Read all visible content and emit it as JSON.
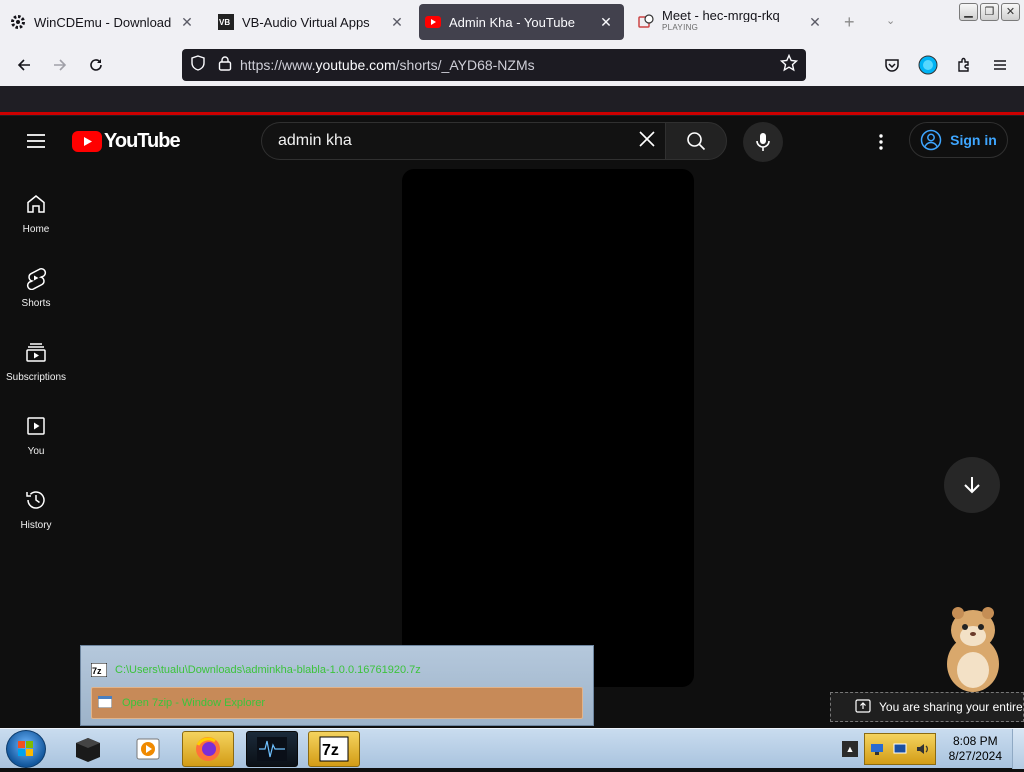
{
  "browser": {
    "tabs": [
      {
        "title": "WinCDEmu - Download",
        "icon": "gear-icon"
      },
      {
        "title": "VB-Audio Virtual Apps",
        "icon": "vb-logo-icon"
      },
      {
        "title": "Admin Kha - YouTube",
        "icon": "youtube-icon",
        "active": true
      },
      {
        "title": "Meet - hec-mrgq-rkq",
        "subtitle": "PLAYING",
        "icon": "meet-icon"
      }
    ],
    "url_prefix": "https://www.",
    "url_domain": "youtube.com",
    "url_path": "/shorts/_AYD68-NZMs"
  },
  "youtube": {
    "logo_text": "YouTube",
    "search_value": "admin kha",
    "signin_label": "Sign in",
    "sidebar": [
      {
        "label": "Home",
        "icon": "home-icon"
      },
      {
        "label": "Shorts",
        "icon": "shorts-icon"
      },
      {
        "label": "Subscriptions",
        "icon": "subscriptions-icon"
      },
      {
        "label": "You",
        "icon": "you-icon"
      },
      {
        "label": "History",
        "icon": "history-icon"
      }
    ]
  },
  "jumplist": {
    "items": [
      {
        "text": "C:\\Users\\tualu\\Downloads\\adminkha-blabla-1.0.0.16761920.7z",
        "icon": "7zip-icon"
      },
      {
        "text": "Open 7zip - Window Explorer",
        "icon": "window-icon",
        "selected": true
      }
    ]
  },
  "sharing": {
    "text": "You are sharing your entire"
  },
  "taskbar": {
    "time": "8:08 PM",
    "date": "8/27/2024"
  },
  "colors": {
    "accent_red": "#cc0000",
    "link_blue": "#3ea6ff",
    "tab_active": "#42414d"
  }
}
